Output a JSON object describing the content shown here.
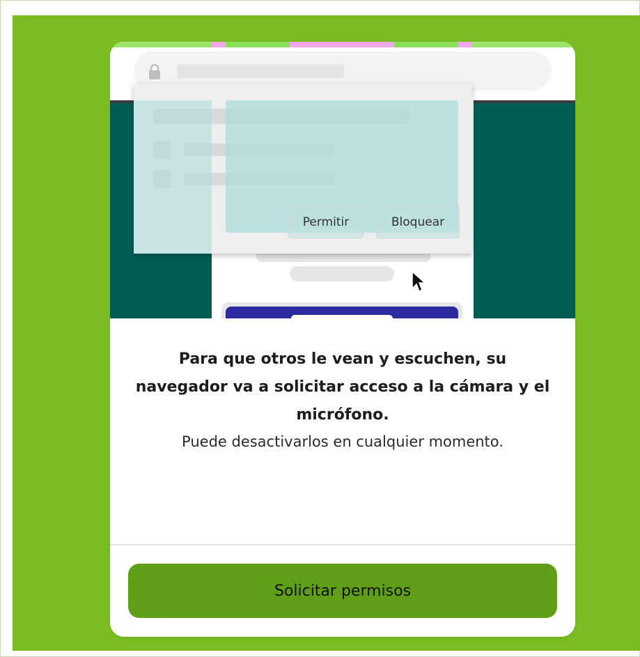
{
  "colors": {
    "page_bg": "#7bbd22",
    "card_bg": "#ffffff",
    "illustration_teal": "#005e55",
    "cta_bg": "#5f9f17",
    "overlay_teal": "#aadcda",
    "inner_button": "#2d2aa0"
  },
  "illustration": {
    "icon": "lock-icon",
    "popup": {
      "allow_label": "Permitir",
      "block_label": "Bloquear"
    },
    "cursor_icon": "mouse-pointer-icon"
  },
  "message": {
    "bold_text": "Para que otros le vean y escuchen, su navegador va a solicitar acceso a la cámara y el micrófono.",
    "normal_text": "Puede desactivarlos en cualquier momento."
  },
  "cta": {
    "label": "Solicitar permisos"
  }
}
